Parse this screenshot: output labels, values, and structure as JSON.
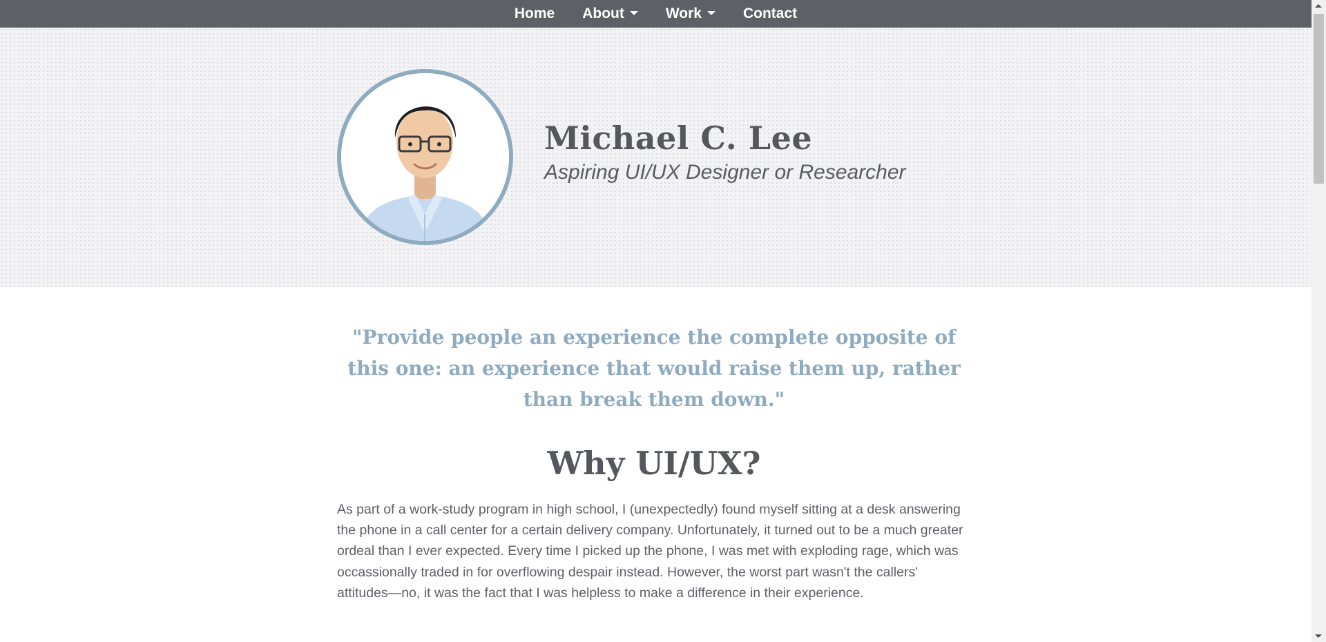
{
  "nav": {
    "items": [
      {
        "label": "Home",
        "dropdown": false
      },
      {
        "label": "About",
        "dropdown": true
      },
      {
        "label": "Work",
        "dropdown": true
      },
      {
        "label": "Contact",
        "dropdown": false
      }
    ]
  },
  "hero": {
    "name": "Michael C. Lee",
    "tagline": "Aspiring UI/UX Designer or Researcher"
  },
  "main": {
    "quote": "\"Provide people an experience the complete opposite of this one: an experience that would raise them up, rather than break them down.\"",
    "section_title": "Why UI/UX?",
    "paragraph": "As part of a work-study program in high school, I (unexpectedly) found myself sitting at a desk answering the phone in a call center for a certain delivery company. Unfortunately, it turned out to be a much greater ordeal than I ever expected. Every time I picked up the phone, I was met with exploding rage, which was occassionally traded in for overflowing despair instead. However, the worst part wasn't the callers' attitudes—no, it was the fact that I was helpless to make a difference in their experience."
  },
  "colors": {
    "navbar": "#5f6065",
    "accent": "#8eabbf",
    "heading": "#56575c",
    "hero_bg": "#f3f3f6"
  }
}
